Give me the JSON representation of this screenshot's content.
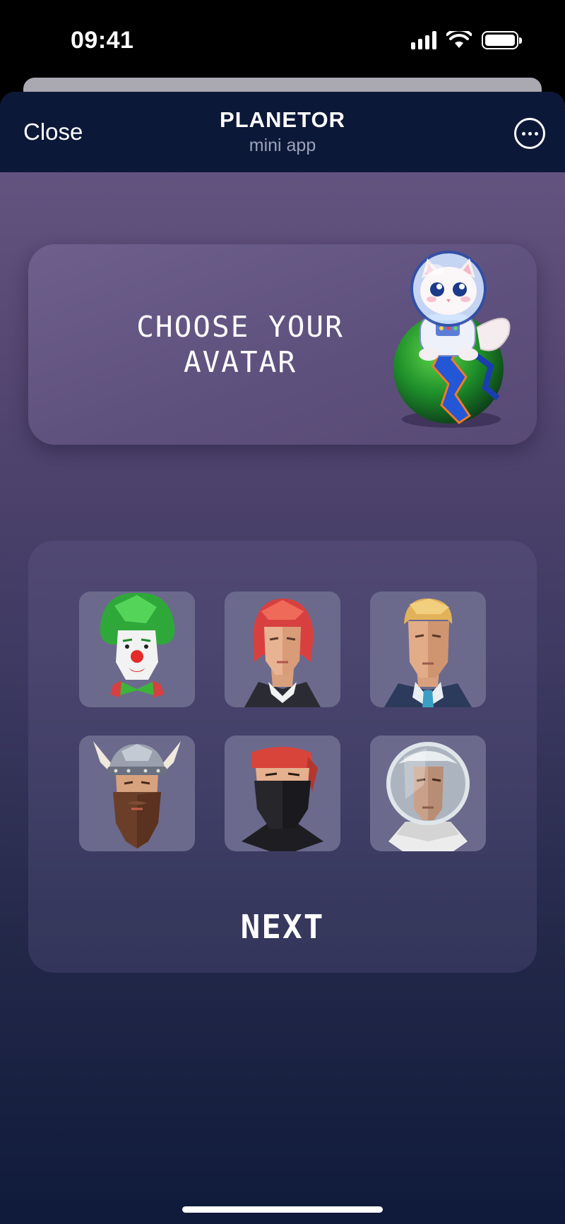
{
  "status_bar": {
    "time": "09:41",
    "icons": [
      "signal-icon",
      "wifi-icon",
      "battery-icon"
    ]
  },
  "header": {
    "close_label": "Close",
    "title": "PLANETOR",
    "subtitle": "mini app",
    "more_icon": "more-icon"
  },
  "banner": {
    "title_line1": "CHOOSE YOUR",
    "title_line2": "AVATAR",
    "illustration": "astronaut-cat-on-planet"
  },
  "avatars": [
    {
      "id": "clown",
      "icon": "clown-avatar"
    },
    {
      "id": "red-haired-woman",
      "icon": "woman-avatar"
    },
    {
      "id": "blond-man",
      "icon": "man-avatar"
    },
    {
      "id": "viking",
      "icon": "viking-avatar"
    },
    {
      "id": "ninja",
      "icon": "ninja-avatar"
    },
    {
      "id": "astronaut",
      "icon": "astronaut-avatar"
    }
  ],
  "next_label": "NEXT",
  "colors": {
    "header_bg": "#0c1838",
    "gradient_top": "#685885",
    "gradient_bottom": "#0f1a3a",
    "tile_bg": "#6b6a8c"
  }
}
